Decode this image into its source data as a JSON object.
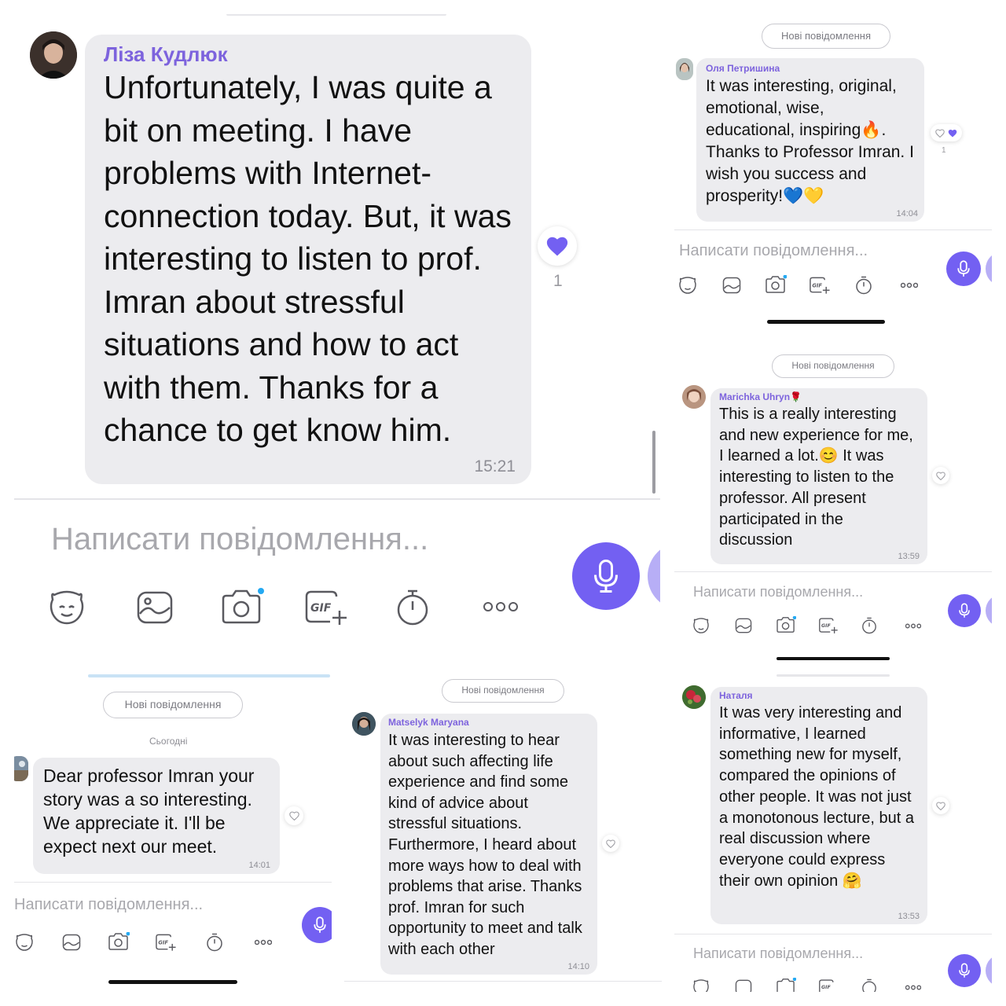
{
  "panel1": {
    "sender": "Ліза Кудлюк",
    "message": "Unfortunately, I was quite a bit on meeting. I have problems with Internet-connection today. But, it was interesting to listen to prof. Imran about stressful situations and how to act with them. Thanks for a chance to get know him.",
    "time": "15:21",
    "reaction_count": "1",
    "input_placeholder": "Написати повідомлення..."
  },
  "panel2": {
    "banner": "Нові повідомлення",
    "sender": "Оля Петришина",
    "message": "It was interesting, original, emotional, wise, educational, inspiring🔥. Thanks to Professor Imran. I wish you success and prosperity!💙💛",
    "time": "14:04",
    "reaction_count": "1",
    "input_placeholder": "Написати повідомлення..."
  },
  "panel3": {
    "banner": "Нові повідомлення",
    "sender": "Marichka Uhryn🌹",
    "message": "This is a really interesting and new experience for me, I learned a lot.😊 It was interesting to listen to the professor. All present participated in the discussion",
    "time": "13:59",
    "input_placeholder": "Написати повідомлення..."
  },
  "panel4": {
    "banner": "Нові повідомлення",
    "date_label": "Сьогодні",
    "message": "Dear professor Imran your story was a so interesting. We appreciate it. I'll be expect next our meet.",
    "time": "14:01",
    "input_placeholder": "Написати повідомлення..."
  },
  "panel5": {
    "banner": "Нові повідомлення",
    "sender": "Matselyk Maryana",
    "message": "It was interesting to hear about such affecting life experience and find some kind of advice about stressful situations. Furthermore, I heard about more ways how to deal with problems that arise. Thanks prof. Imran for such opportunity to meet and talk with each other",
    "time": "14:10"
  },
  "panel6": {
    "sender": "Наталя",
    "message": "It was very interesting and informative, I learned something new for myself, compared the opinions of other people.  It was not just a monotonous lecture, but a real discussion where everyone could express their own opinion 🤗",
    "time": "13:53",
    "input_placeholder": "Написати повідомлення..."
  },
  "toolbar_icons": [
    "sticker-icon",
    "gallery-icon",
    "camera-icon",
    "gif-icon",
    "timer-icon",
    "more-icon"
  ],
  "colors": {
    "accent": "#7360f2",
    "sender": "#7d63dd",
    "bubble": "#ececef"
  }
}
